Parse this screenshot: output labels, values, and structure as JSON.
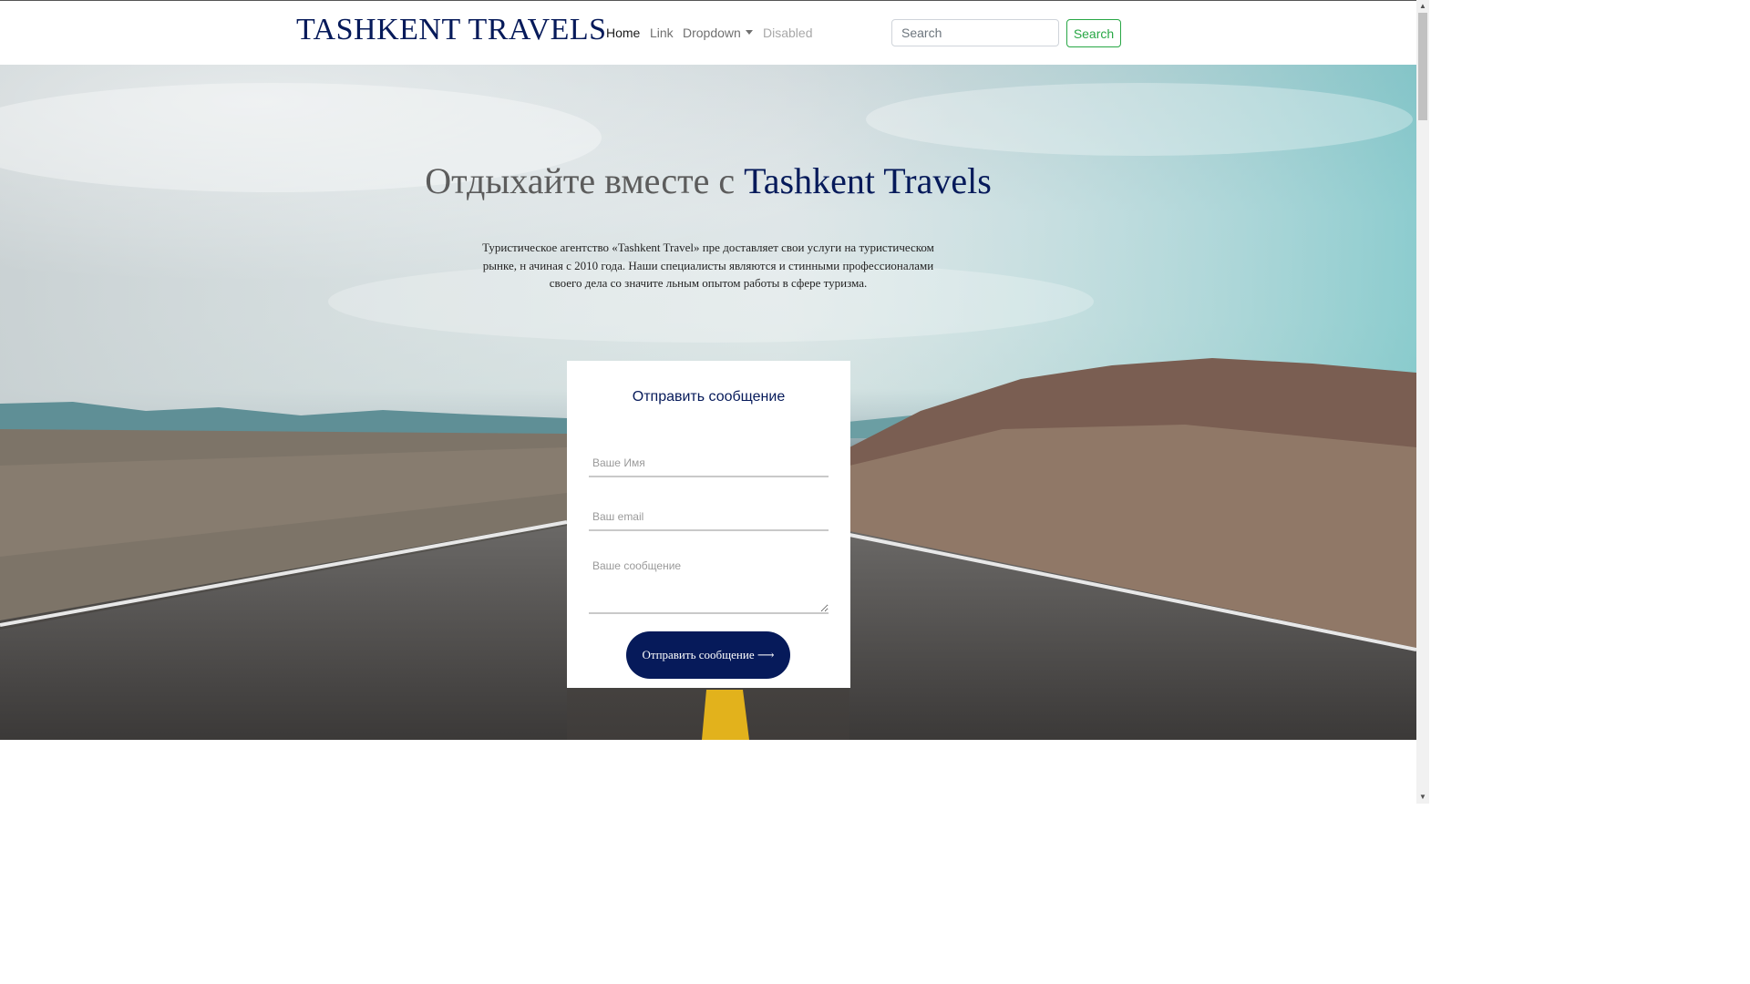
{
  "navbar": {
    "brand": "TASHKENT TRAVELS",
    "links": [
      {
        "label": "Home"
      },
      {
        "label": "Link"
      },
      {
        "label": "Dropdown"
      },
      {
        "label": "Disabled"
      }
    ],
    "search_placeholder": "Search",
    "search_button": "Search"
  },
  "hero": {
    "title_part1": "Отдыхайте вместе с ",
    "title_accent": "Tashkent Travels",
    "text": "Туристическое агентство «Tashkent Travel» пре доставляет свои услуги на туристическом рынке, н ачиная с 2010 года. Наши специалисты являются и стинными профессионалами своего дела со значите льным опытом работы в сфере туризма."
  },
  "form": {
    "title": "Отправить сообщение",
    "name_placeholder": "Ваше Имя",
    "email_placeholder": "Ваш email",
    "message_placeholder": "Ваше сообщение",
    "submit_label": "Отправить сообщение ⟶"
  },
  "colors": {
    "brand_navy": "#061a5a",
    "success_green": "#28a745"
  },
  "icons": {
    "dropdown_caret": "caret-down-icon",
    "arrow": "arrow-right-icon",
    "resize": "resize-handle-icon"
  }
}
